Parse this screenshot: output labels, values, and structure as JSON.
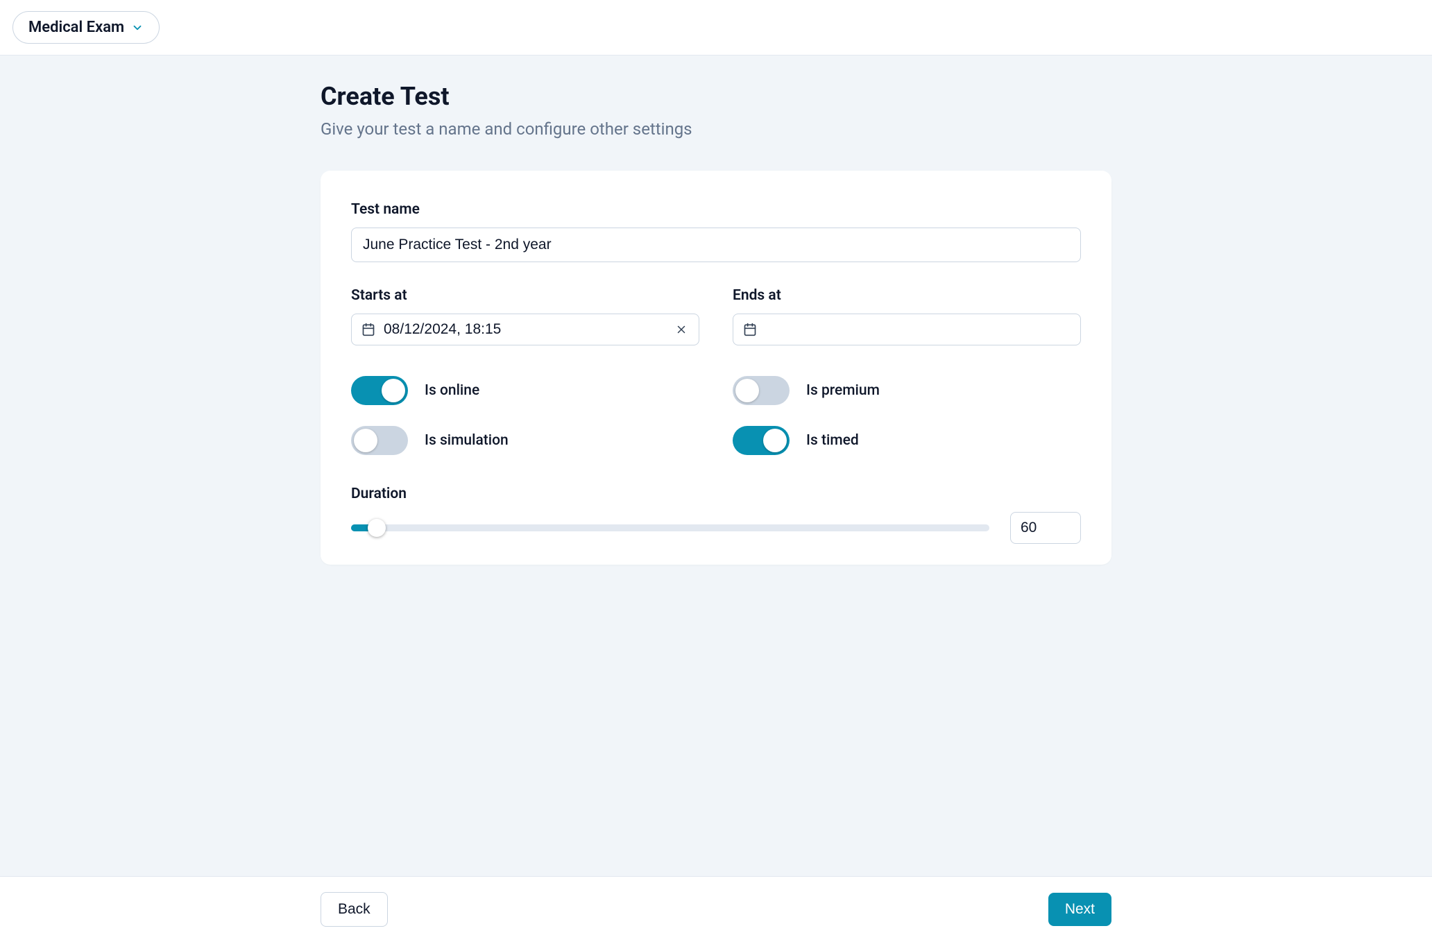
{
  "header": {
    "dropdown_label": "Medical Exam"
  },
  "page": {
    "title": "Create Test",
    "subtitle": "Give your test a name and configure other settings"
  },
  "form": {
    "test_name_label": "Test name",
    "test_name_value": "June Practice Test - 2nd year",
    "starts_at_label": "Starts at",
    "starts_at_value": "08/12/2024, 18:15",
    "ends_at_label": "Ends at",
    "ends_at_value": "",
    "toggles": {
      "is_online": {
        "label": "Is online",
        "value": true
      },
      "is_premium": {
        "label": "Is premium",
        "value": false
      },
      "is_simulation": {
        "label": "Is simulation",
        "value": false
      },
      "is_timed": {
        "label": "Is timed",
        "value": true
      }
    },
    "duration_label": "Duration",
    "duration_value": "60"
  },
  "footer": {
    "back_label": "Back",
    "next_label": "Next"
  }
}
